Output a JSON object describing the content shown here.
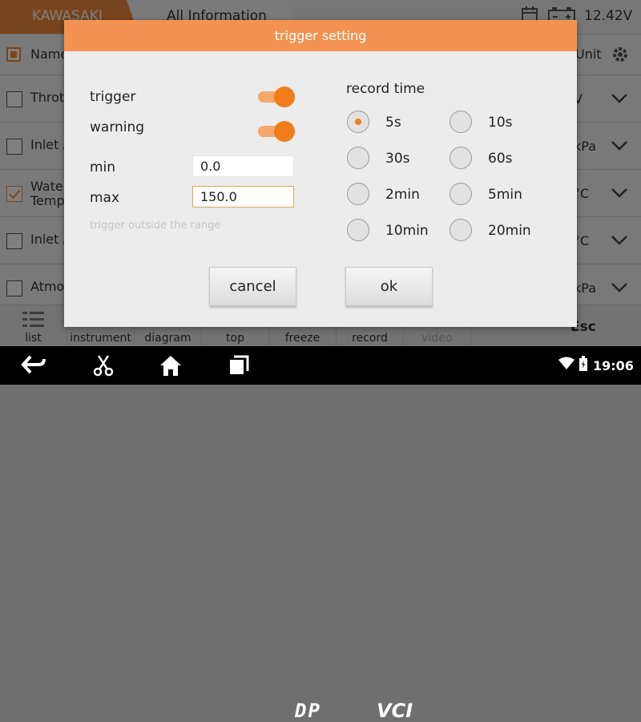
{
  "background": {
    "tabs": [
      "KAWASAKI",
      "All Information"
    ],
    "voltage": "12.42V",
    "list_header": {
      "name": "Name",
      "unit": "Unit"
    },
    "rows": [
      {
        "label": "Throt",
        "unit": "V"
      },
      {
        "label": "Inlet A",
        "unit": "kPa"
      },
      {
        "label": "Water Temp",
        "unit": "°C"
      },
      {
        "label": "Inlet A",
        "unit": "°C"
      },
      {
        "label": "Atmo",
        "unit": "kPa"
      }
    ],
    "toolbar": [
      "list",
      "instrument",
      "diagram",
      "top",
      "freeze",
      "record",
      "video"
    ],
    "esc_label": "Esc"
  },
  "dialog": {
    "title": "trigger setting",
    "trigger_label": "trigger",
    "trigger_on": true,
    "warning_label": "warning",
    "warning_on": true,
    "min_label": "min",
    "min_value": "0.0",
    "max_label": "max",
    "max_value": "150.0",
    "hint": "trigger outside the range",
    "record_time_label": "record time",
    "record_options": [
      "5s",
      "10s",
      "30s",
      "60s",
      "2min",
      "5min",
      "10min",
      "20min"
    ],
    "selected_record": "5s",
    "cancel_label": "cancel",
    "ok_label": "ok"
  },
  "navbar": {
    "time": "19:06",
    "dp_label": "DP",
    "vci_label": "VCI"
  },
  "colors": {
    "accent": "#f07c1a",
    "header": "#f49351"
  }
}
